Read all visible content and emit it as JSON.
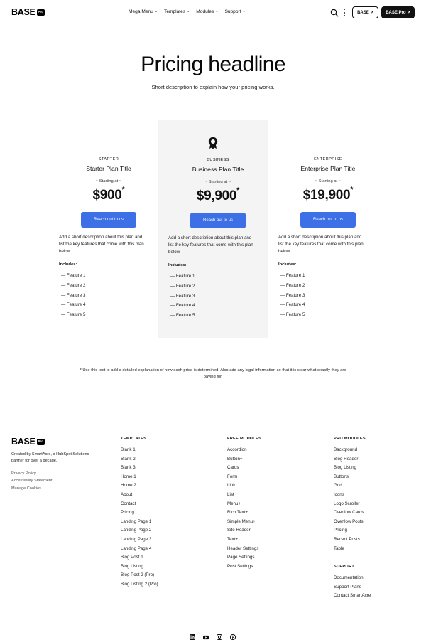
{
  "header": {
    "logo_text": "BASE",
    "logo_badge": "Pro",
    "nav": [
      {
        "label": "Mega Menu"
      },
      {
        "label": "Templates"
      },
      {
        "label": "Modules"
      },
      {
        "label": "Support"
      }
    ],
    "btn_base": "BASE",
    "btn_base_pro": "BASE Pro"
  },
  "hero": {
    "title": "Pricing headline",
    "subtitle": "Short description to explain how your pricing works."
  },
  "plans": [
    {
      "kicker": "STARTER",
      "title": "Starter Plan Title",
      "starting": "~ Starting at ~",
      "price": "$900",
      "price_mark": "*",
      "button": "Reach out to us",
      "description": "Add a short description about this plan and list the key features that come with this plan below.",
      "includes": "Includes:",
      "features": [
        "— Feature 1",
        "— Feature 2",
        "— Feature 3",
        "— Feature 4",
        "— Feature 5"
      ]
    },
    {
      "kicker": "BUSINESS",
      "title": "Business Plan Title",
      "starting": "~ Starting at ~",
      "price": "$9,900",
      "price_mark": "*",
      "button": "Reach out to us",
      "description": "Add a short description about this plan and list the key features that come with this plan below.",
      "includes": "Includes:",
      "features": [
        "— Feature 1",
        "— Feature 2",
        "— Feature 3",
        "— Feature 4",
        "— Feature 5"
      ]
    },
    {
      "kicker": "ENTERPRISE",
      "title": "Enterprise Plan Title",
      "starting": "~ Starting at ~",
      "price": "$19,900",
      "price_mark": "*",
      "button": "Reach out to us",
      "description": "Add a short description about this plan and list the key features that come with this plan below.",
      "includes": "Includes:",
      "features": [
        "— Feature 1",
        "— Feature 2",
        "— Feature 3",
        "— Feature 4",
        "— Feature 5"
      ]
    }
  ],
  "note": "* Use this text to add a detailed explanation of how each price is determined. Also add any legal information so that it is clear what exactly they are paying for.",
  "footer": {
    "logo_text": "BASE",
    "logo_badge": "Pro",
    "description": "Created by SmartAcre, a HubSpot Solutions partner for over a decade.",
    "links": [
      "Privacy Policy",
      "Accessibility Statement",
      "Manage Cookies"
    ],
    "columns": [
      {
        "title": "TEMPLATES",
        "items": [
          "Blank 1",
          "Blank 2",
          "Blank 3",
          "Home 1",
          "Home 2",
          "About",
          "Contact",
          "Pricing",
          "Landing Page 1",
          "Landing Page 2",
          "Landing Page 3",
          "Landing Page 4",
          "Blog Post 1",
          "Blog Listing 1",
          "Blog Post 2 (Pro)",
          "Blog Listing 2 (Pro)"
        ]
      },
      {
        "title": "FREE MODULES",
        "items": [
          "Accordion",
          "Button+",
          "Cards",
          "Form+",
          "Link",
          "List",
          "Menu+",
          "Rich Text+",
          "Simple Menu+",
          "Site Header",
          "Text+",
          "Header Settings",
          "Page Settings",
          "Post Settings"
        ]
      },
      {
        "title": "PRO MODULES",
        "items": [
          "Background",
          "Blog Header",
          "Blog Listing",
          "Buttons",
          "Grid",
          "Icons",
          "Logo Scroller",
          "Overflow Cards",
          "Overflow Posts",
          "Pricing",
          "Recent Posts",
          "Table"
        ]
      },
      {
        "title": "SUPPORT",
        "items": [
          "Documentation",
          "Support Plans",
          "Contact SmartAcre"
        ]
      }
    ],
    "socials": [
      "linkedin-icon",
      "youtube-icon",
      "instagram-icon",
      "pinterest-icon"
    ]
  },
  "colors": {
    "accent_button": "#3d6fe6",
    "highlight_bg": "#f4f4f4",
    "dark": "#111111"
  }
}
